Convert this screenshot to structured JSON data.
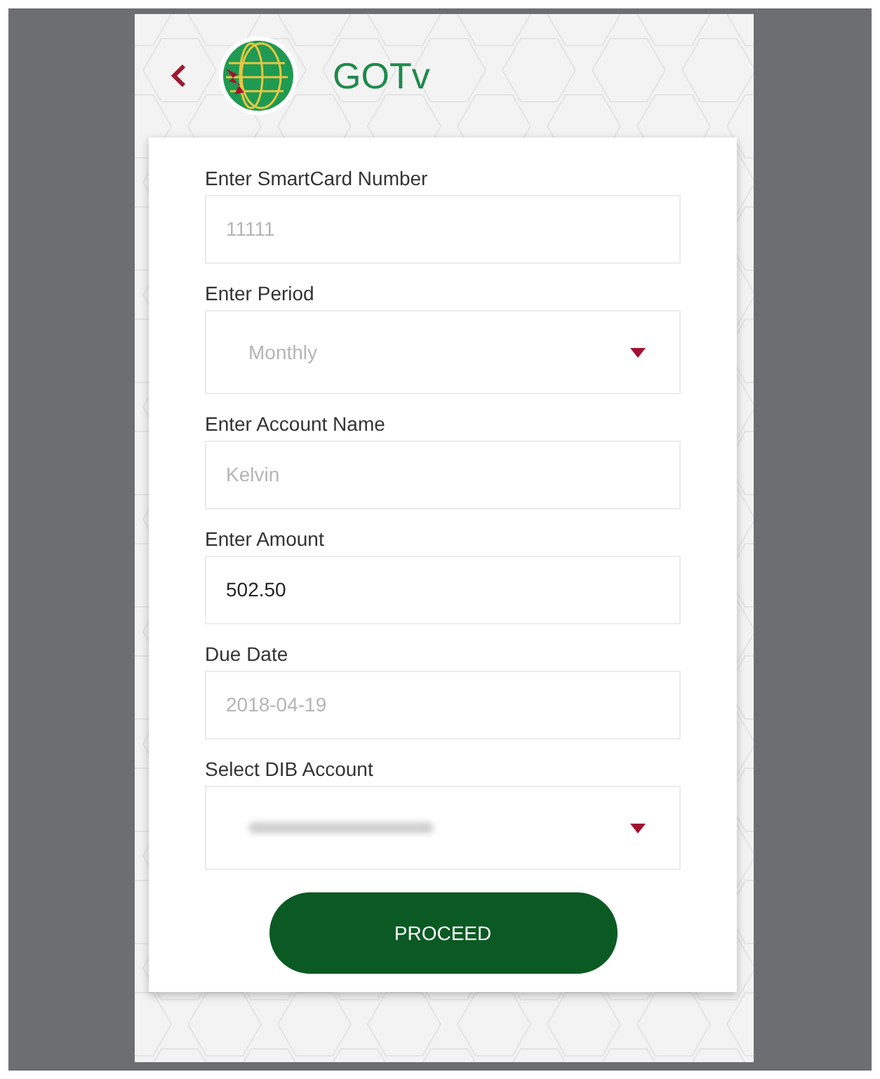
{
  "header": {
    "title": "GOTv"
  },
  "form": {
    "fields": [
      {
        "kind": "input",
        "label": "Enter SmartCard Number",
        "value": "11111",
        "disabled": true
      },
      {
        "kind": "select",
        "label": "Enter Period",
        "value": "Monthly",
        "disabled": true
      },
      {
        "kind": "input",
        "label": "Enter Account Name",
        "value": "Kelvin",
        "disabled": true
      },
      {
        "kind": "input",
        "label": "Enter Amount",
        "value": "502.50",
        "disabled": false
      },
      {
        "kind": "input",
        "label": "Due Date",
        "value": "2018-04-19",
        "disabled": true
      },
      {
        "kind": "select",
        "label": "Select DIB Account",
        "redacted": true,
        "disabled": true
      }
    ],
    "button": "PROCEED"
  }
}
